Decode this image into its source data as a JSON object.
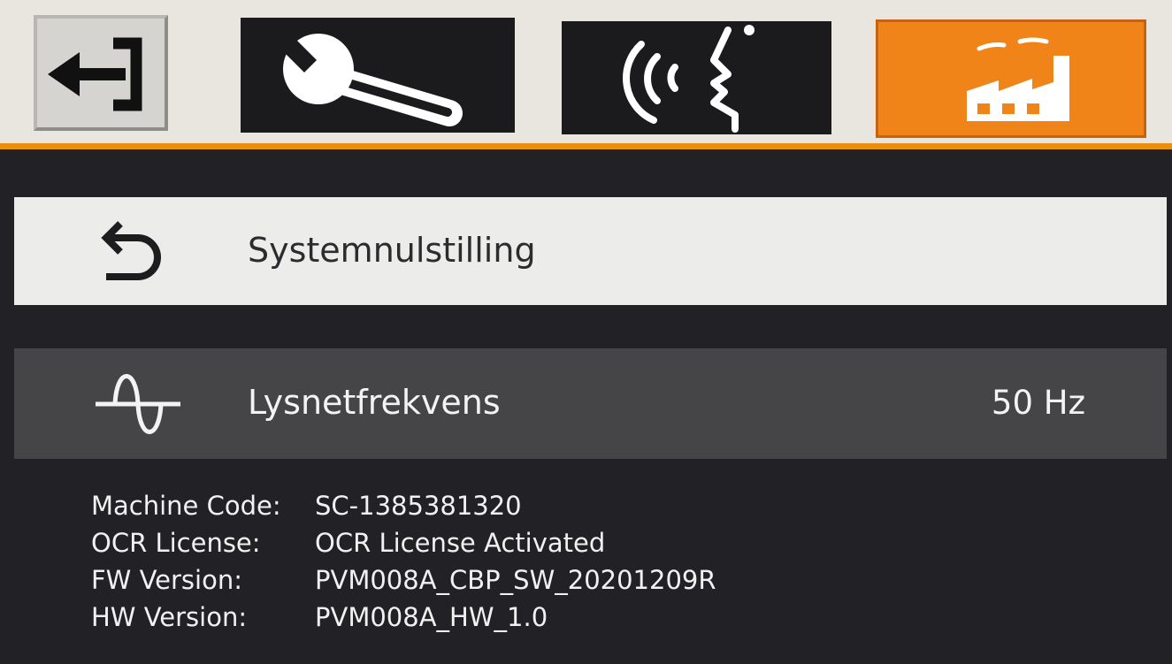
{
  "tabs": [
    {
      "name": "exit",
      "icon": "exit-arrow-icon",
      "active": false
    },
    {
      "name": "settings",
      "icon": "wrench-icon",
      "active": false
    },
    {
      "name": "voice",
      "icon": "speaking-head-icon",
      "active": false
    },
    {
      "name": "factory",
      "icon": "factory-icon",
      "active": true
    }
  ],
  "colors": {
    "accent": "#f08418",
    "tab_bar": "#e9e6e0",
    "tab_dark": "#1b1a1d",
    "row_selected": "#ececeb",
    "row_normal": "#454547",
    "background": "#222124"
  },
  "menu": {
    "reset": {
      "label": "Systemnulstilling",
      "icon": "reset-return-icon"
    },
    "frequency": {
      "label": "Lysnetfrekvens",
      "value": "50 Hz",
      "icon": "sine-wave-icon"
    }
  },
  "info": [
    {
      "key": "Machine Code:",
      "value": "SC-1385381320"
    },
    {
      "key": "OCR License:",
      "value": "OCR License Activated"
    },
    {
      "key": "FW Version:",
      "value": "PVM008A_CBP_SW_20201209R"
    },
    {
      "key": "HW Version:",
      "value": "PVM008A_HW_1.0"
    }
  ]
}
